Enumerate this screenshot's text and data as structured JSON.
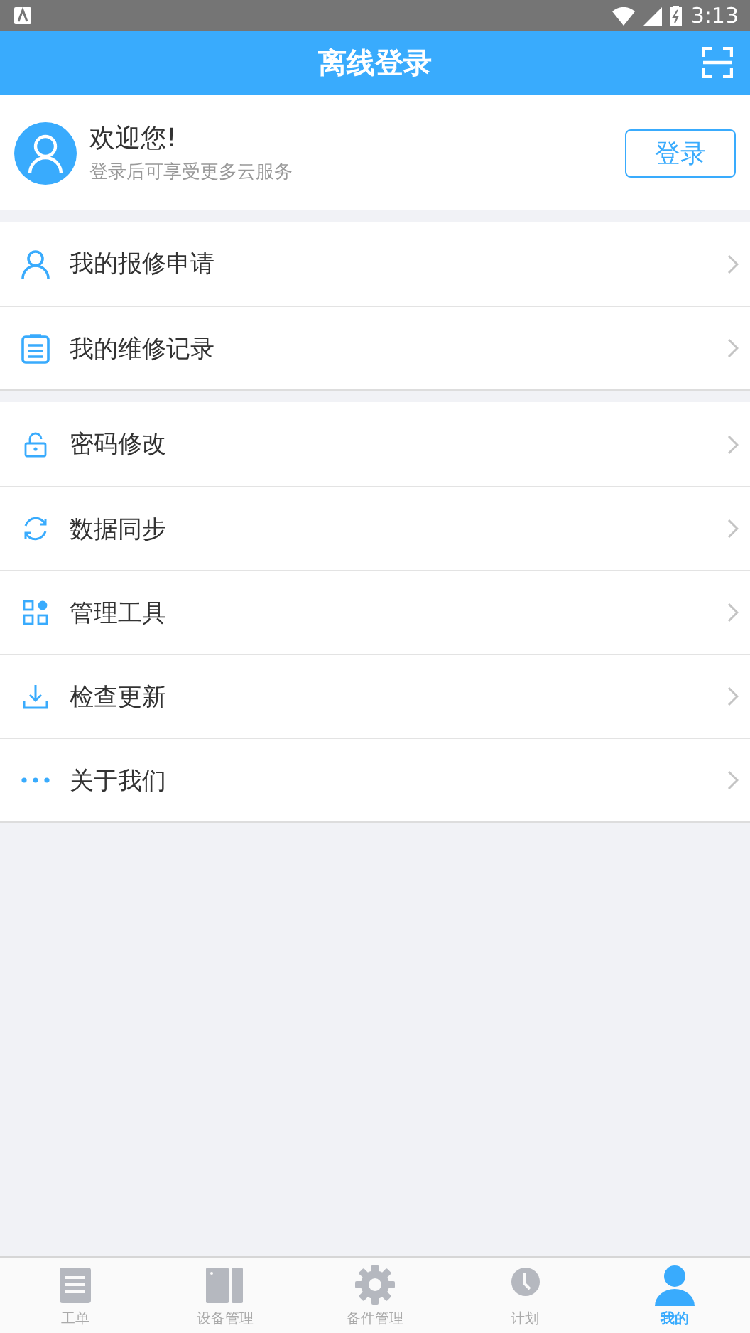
{
  "status_bar": {
    "time": "3:13"
  },
  "header": {
    "title": "离线登录"
  },
  "profile": {
    "greeting": "欢迎您!",
    "subtitle": "登录后可享受更多云服务",
    "login_button": "登录"
  },
  "menu_groups": [
    {
      "items": [
        {
          "kind": "person",
          "label": "我的报修申请"
        },
        {
          "kind": "clipboard",
          "label": "我的维修记录"
        }
      ]
    },
    {
      "items": [
        {
          "kind": "lock",
          "label": "密码修改"
        },
        {
          "kind": "sync",
          "label": "数据同步"
        },
        {
          "kind": "apps",
          "label": "管理工具"
        },
        {
          "kind": "download",
          "label": "检查更新"
        },
        {
          "kind": "more",
          "label": "关于我们"
        }
      ]
    }
  ],
  "tab_bar": [
    {
      "kind": "doc",
      "label": "工单",
      "selected": false
    },
    {
      "kind": "book",
      "label": "设备管理",
      "selected": false
    },
    {
      "kind": "gear",
      "label": "备件管理",
      "selected": false
    },
    {
      "kind": "clock",
      "label": "计划",
      "selected": false
    },
    {
      "kind": "user",
      "label": "我的",
      "selected": true
    }
  ]
}
